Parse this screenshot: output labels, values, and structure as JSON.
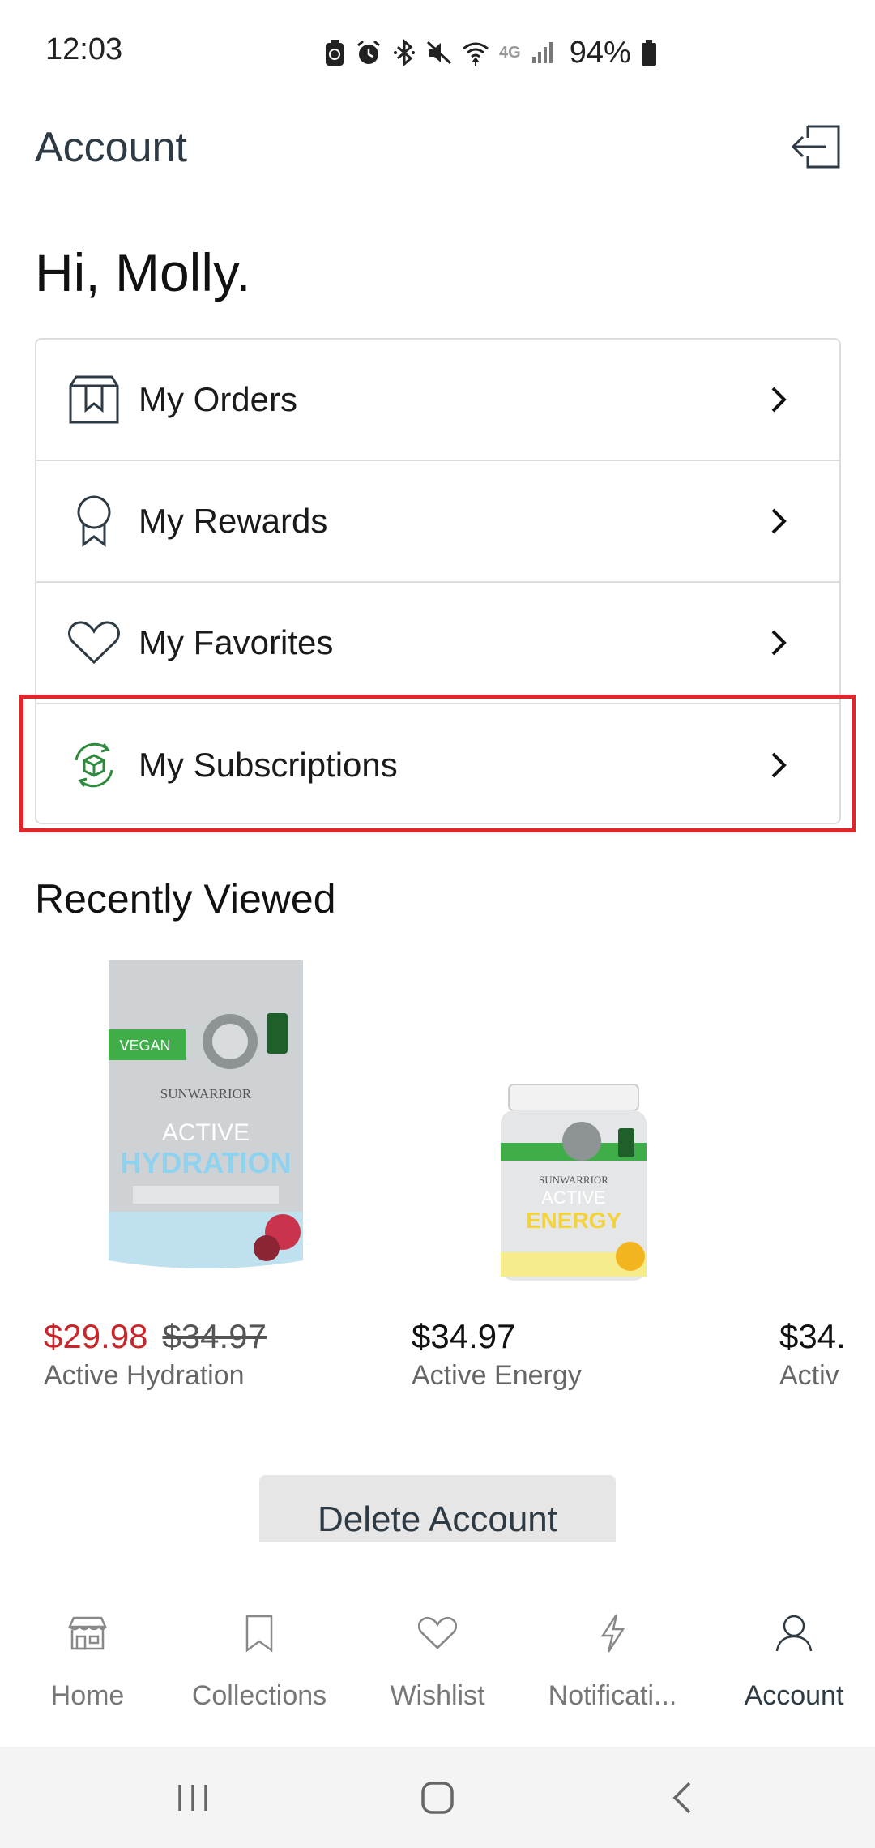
{
  "status_bar": {
    "time": "12:03",
    "battery_percent": "94%",
    "network": "4G"
  },
  "header": {
    "title": "Account"
  },
  "greeting": "Hi, Molly.",
  "menu": {
    "items": [
      {
        "label": "My Orders",
        "icon": "box-icon"
      },
      {
        "label": "My Rewards",
        "icon": "award-ribbon-icon"
      },
      {
        "label": "My Favorites",
        "icon": "heart-icon"
      },
      {
        "label": "My Subscriptions",
        "icon": "subscription-cycle-icon",
        "highlighted": true
      }
    ]
  },
  "recently_viewed": {
    "title": "Recently Viewed",
    "products": [
      {
        "name": "Active Hydration",
        "sale_price": "$29.98",
        "original_price": "$34.97"
      },
      {
        "name": "Active Energy",
        "price": "$34.97"
      },
      {
        "name": "Activ",
        "price": "$34."
      }
    ]
  },
  "delete_account_label": "Delete Account",
  "bottom_nav": {
    "items": [
      {
        "label": "Home",
        "icon": "store-icon"
      },
      {
        "label": "Collections",
        "icon": "bookmark-icon"
      },
      {
        "label": "Wishlist",
        "icon": "heart-icon"
      },
      {
        "label": "Notificati...",
        "icon": "lightning-icon"
      },
      {
        "label": "Account",
        "icon": "user-icon",
        "active": true
      }
    ]
  },
  "colors": {
    "accent_green": "#2e8b3e",
    "sale_red": "#c8262a",
    "highlight_red": "#e0262a",
    "title_gray": "#2f3b44"
  }
}
